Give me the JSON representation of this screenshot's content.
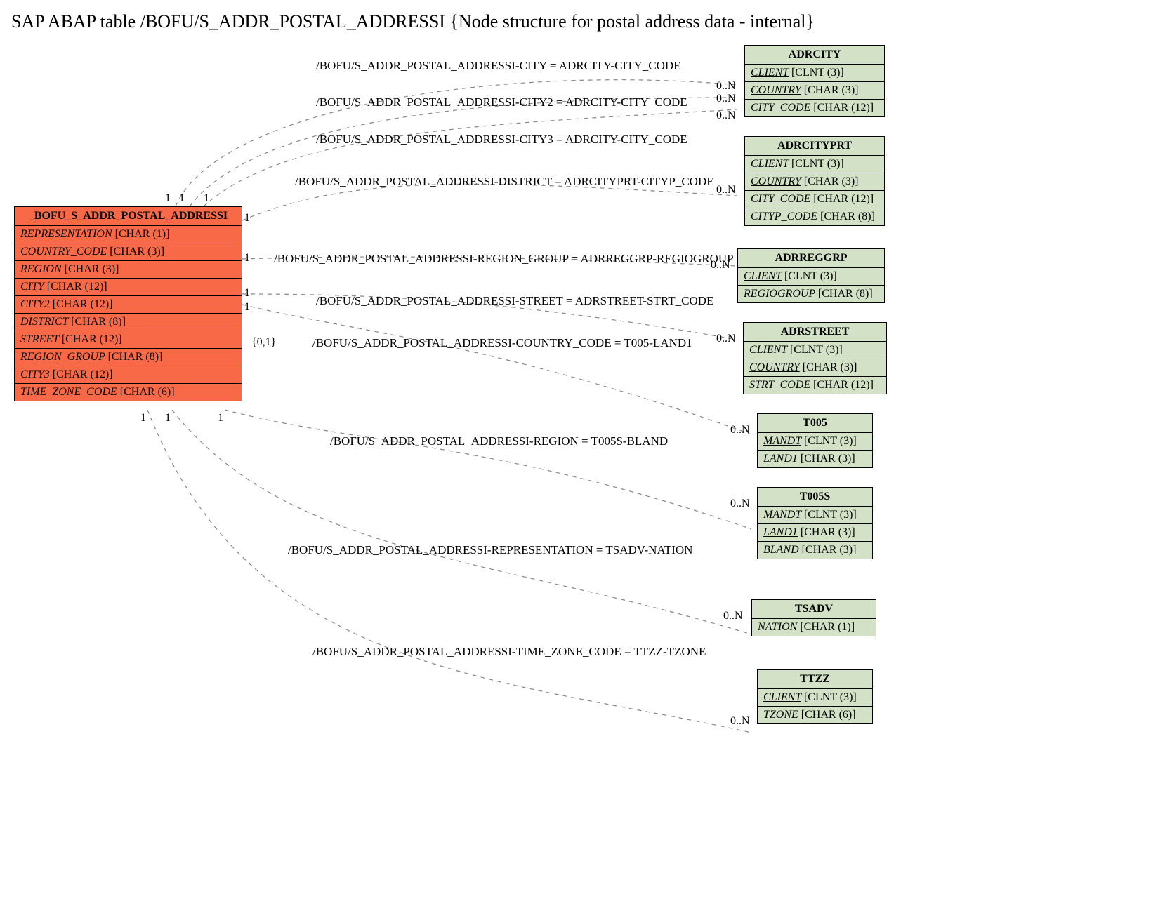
{
  "title": "SAP ABAP table /BOFU/S_ADDR_POSTAL_ADDRESSI {Node structure for postal address data - internal}",
  "source_entity": {
    "name": "_BOFU_S_ADDR_POSTAL_ADDRESSI",
    "fields": [
      {
        "name": "REPRESENTATION",
        "type": "[CHAR (1)]"
      },
      {
        "name": "COUNTRY_CODE",
        "type": "[CHAR (3)]"
      },
      {
        "name": "REGION",
        "type": "[CHAR (3)]"
      },
      {
        "name": "CITY",
        "type": "[CHAR (12)]"
      },
      {
        "name": "CITY2",
        "type": "[CHAR (12)]"
      },
      {
        "name": "DISTRICT",
        "type": "[CHAR (8)]"
      },
      {
        "name": "STREET",
        "type": "[CHAR (12)]"
      },
      {
        "name": "REGION_GROUP",
        "type": "[CHAR (8)]"
      },
      {
        "name": "CITY3",
        "type": "[CHAR (12)]"
      },
      {
        "name": "TIME_ZONE_CODE",
        "type": "[CHAR (6)]"
      }
    ]
  },
  "target_entities": [
    {
      "name": "ADRCITY",
      "fields": [
        {
          "name": "CLIENT",
          "type": "[CLNT (3)]",
          "key": true
        },
        {
          "name": "COUNTRY",
          "type": "[CHAR (3)]",
          "key": true
        },
        {
          "name": "CITY_CODE",
          "type": "[CHAR (12)]",
          "key": false
        }
      ]
    },
    {
      "name": "ADRCITYPRT",
      "fields": [
        {
          "name": "CLIENT",
          "type": "[CLNT (3)]",
          "key": true
        },
        {
          "name": "COUNTRY",
          "type": "[CHAR (3)]",
          "key": true
        },
        {
          "name": "CITY_CODE",
          "type": "[CHAR (12)]",
          "key": true
        },
        {
          "name": "CITYP_CODE",
          "type": "[CHAR (8)]",
          "key": false
        }
      ]
    },
    {
      "name": "ADRREGGRP",
      "fields": [
        {
          "name": "CLIENT",
          "type": "[CLNT (3)]",
          "key": true
        },
        {
          "name": "REGIOGROUP",
          "type": "[CHAR (8)]",
          "key": false
        }
      ]
    },
    {
      "name": "ADRSTREET",
      "fields": [
        {
          "name": "CLIENT",
          "type": "[CLNT (3)]",
          "key": true
        },
        {
          "name": "COUNTRY",
          "type": "[CHAR (3)]",
          "key": true
        },
        {
          "name": "STRT_CODE",
          "type": "[CHAR (12)]",
          "key": false
        }
      ]
    },
    {
      "name": "T005",
      "fields": [
        {
          "name": "MANDT",
          "type": "[CLNT (3)]",
          "key": true
        },
        {
          "name": "LAND1",
          "type": "[CHAR (3)]",
          "key": false
        }
      ]
    },
    {
      "name": "T005S",
      "fields": [
        {
          "name": "MANDT",
          "type": "[CLNT (3)]",
          "key": true
        },
        {
          "name": "LAND1",
          "type": "[CHAR (3)]",
          "key": true
        },
        {
          "name": "BLAND",
          "type": "[CHAR (3)]",
          "key": false
        }
      ]
    },
    {
      "name": "TSADV",
      "fields": [
        {
          "name": "NATION",
          "type": "[CHAR (1)]",
          "key": false
        }
      ]
    },
    {
      "name": "TTZZ",
      "fields": [
        {
          "name": "CLIENT",
          "type": "[CLNT (3)]",
          "key": true
        },
        {
          "name": "TZONE",
          "type": "[CHAR (6)]",
          "key": false
        }
      ]
    }
  ],
  "relations": [
    {
      "label": "/BOFU/S_ADDR_POSTAL_ADDRESSI-CITY = ADRCITY-CITY_CODE",
      "left_card": "1",
      "right_card": "0..N"
    },
    {
      "label": "/BOFU/S_ADDR_POSTAL_ADDRESSI-CITY2 = ADRCITY-CITY_CODE",
      "left_card": "1",
      "right_card": "0..N"
    },
    {
      "label": "/BOFU/S_ADDR_POSTAL_ADDRESSI-CITY3 = ADRCITY-CITY_CODE",
      "left_card": "1",
      "right_card": "0..N"
    },
    {
      "label": "/BOFU/S_ADDR_POSTAL_ADDRESSI-DISTRICT = ADRCITYPRT-CITYP_CODE",
      "left_card": "1",
      "right_card": "0..N"
    },
    {
      "label": "/BOFU/S_ADDR_POSTAL_ADDRESSI-REGION_GROUP = ADRREGGRP-REGIOGROUP",
      "left_card": "1",
      "right_card": "0..N"
    },
    {
      "label": "/BOFU/S_ADDR_POSTAL_ADDRESSI-STREET = ADRSTREET-STRT_CODE",
      "left_card": "1",
      "right_card": "0..N"
    },
    {
      "label": "/BOFU/S_ADDR_POSTAL_ADDRESSI-COUNTRY_CODE = T005-LAND1",
      "left_card": "{0,1}",
      "right_card": "0..N"
    },
    {
      "label": "/BOFU/S_ADDR_POSTAL_ADDRESSI-REGION = T005S-BLAND",
      "left_card": "1",
      "right_card": "0..N"
    },
    {
      "label": "/BOFU/S_ADDR_POSTAL_ADDRESSI-REPRESENTATION = TSADV-NATION",
      "left_card": "1",
      "right_card": "0..N"
    },
    {
      "label": "/BOFU/S_ADDR_POSTAL_ADDRESSI-TIME_ZONE_CODE = TTZZ-TZONE",
      "left_card": "1",
      "right_card": "0..N"
    }
  ]
}
